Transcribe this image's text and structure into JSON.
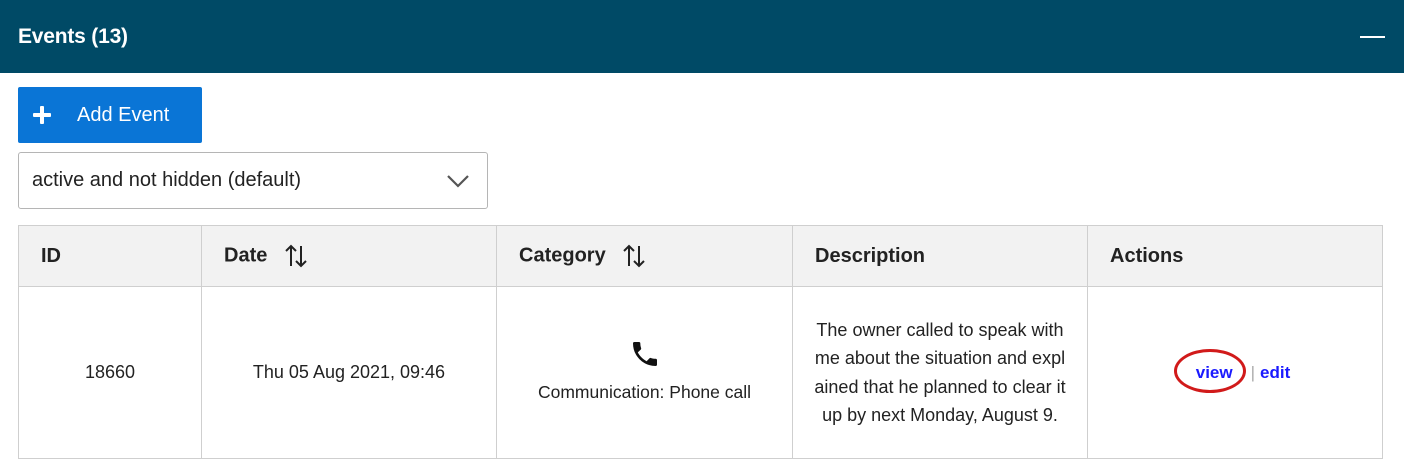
{
  "panel": {
    "title": "Events (13)",
    "header_color": "#004a66"
  },
  "toolbar": {
    "add_event_label": "Add Event",
    "add_icon": "plus-icon",
    "button_color": "#0a75d6"
  },
  "filter": {
    "selected": "active and not hidden (default)",
    "icon": "chevron-down-icon"
  },
  "table": {
    "columns": [
      "ID",
      "Date",
      "Category",
      "Description",
      "Actions"
    ],
    "sortable_columns": [
      "Date",
      "Category"
    ],
    "rows": [
      {
        "id": "18660",
        "date": "Thu 05 Aug 2021, 09:46",
        "category_icon": "phone-icon",
        "category": "Communication: Phone call",
        "description": "The owner called to speak with me about the situation and explained that he planned to clear it up by next Monday, August 9.",
        "actions": [
          "view",
          "edit"
        ]
      }
    ]
  },
  "highlight": {
    "target": "view",
    "color": "#d11a1a"
  }
}
